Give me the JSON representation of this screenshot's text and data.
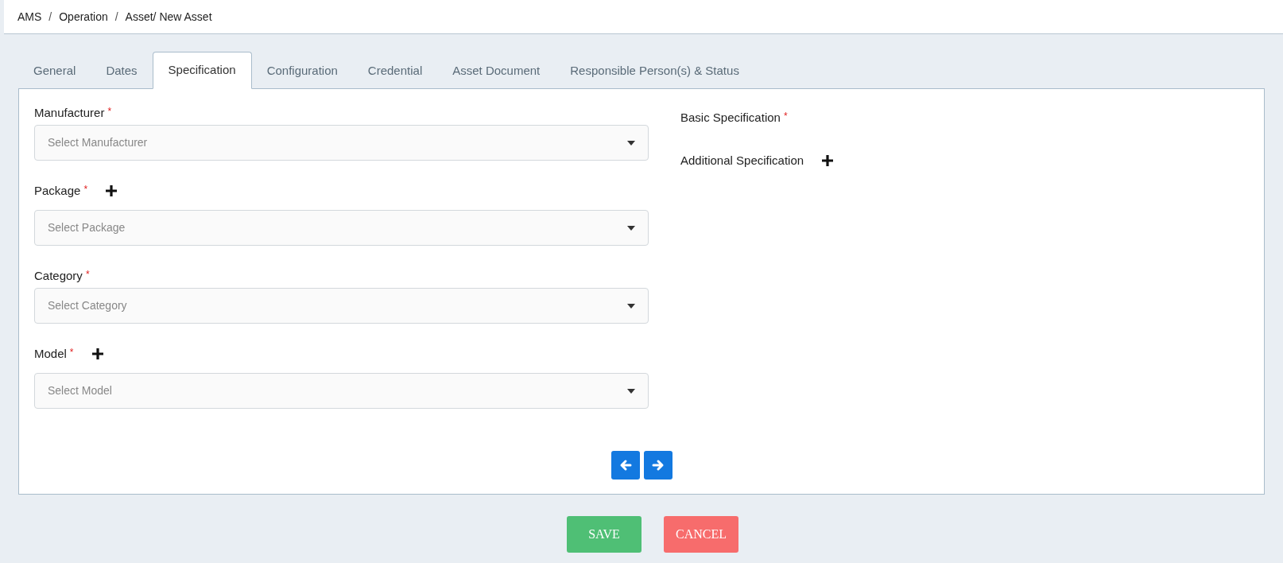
{
  "breadcrumb": [
    {
      "label": "AMS"
    },
    {
      "separator": "/",
      "label": "Operation"
    },
    {
      "separator": "/",
      "label": "Asset/ New Asset"
    }
  ],
  "tabs": [
    {
      "label": "General",
      "selected": false
    },
    {
      "label": "Dates",
      "selected": false
    },
    {
      "label": "Specification",
      "selected": true
    },
    {
      "label": "Configuration",
      "selected": false
    },
    {
      "label": "Credential",
      "selected": false
    },
    {
      "label": "Asset Document",
      "selected": false
    },
    {
      "label": "Responsible Person(s) & Status",
      "selected": false
    }
  ],
  "fields": [
    {
      "label": "Manufacturer",
      "required_mark": "*",
      "add_button": false,
      "placeholder": "Select Manufacturer"
    },
    {
      "label": "Package",
      "required_mark": "*",
      "add_button": true,
      "placeholder": "Select Package"
    },
    {
      "label": "Category",
      "required_mark": "*",
      "add_button": false,
      "placeholder": "Select Category"
    },
    {
      "label": "Model",
      "required_mark": "*",
      "add_button": true,
      "placeholder": "Select Model"
    }
  ],
  "specifications": [
    {
      "label": "Basic Specification",
      "required_mark": "*",
      "add_button": false
    },
    {
      "label": "Additional Specification",
      "add_button": true
    }
  ],
  "actions": [
    {
      "label": "SAVE",
      "kind": "save"
    },
    {
      "label": "CANCEL",
      "kind": "cancel"
    }
  ]
}
